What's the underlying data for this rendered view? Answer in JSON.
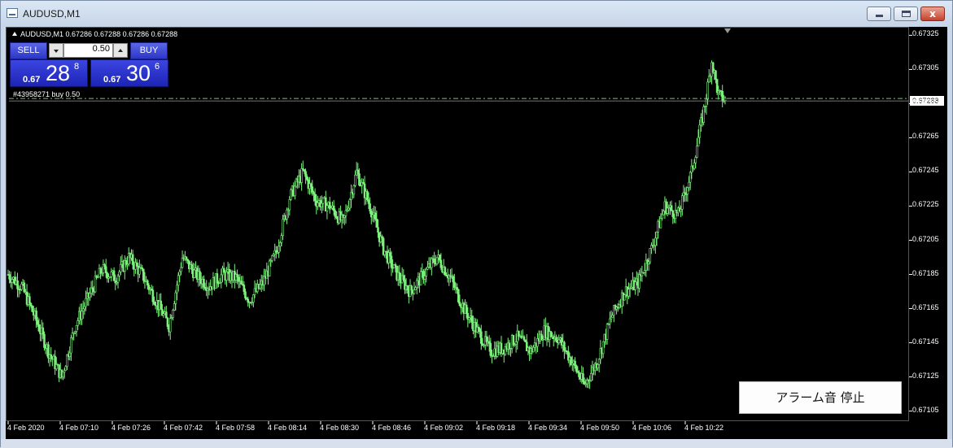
{
  "window": {
    "title": "AUDUSD,M1",
    "close_glyph": "x"
  },
  "symbol_info": "AUDUSD,M1  0.67286 0.67288 0.67286 0.67288",
  "trade_panel": {
    "sell_label": "SELL",
    "buy_label": "BUY",
    "lot_value": "0.50",
    "sell_quote": {
      "prefix": "0.67",
      "big": "28",
      "small": "8"
    },
    "buy_quote": {
      "prefix": "0.67",
      "big": "30",
      "small": "6"
    }
  },
  "order_line_label": "#43958271 buy 0.50",
  "alarm_button_label": "アラーム音 停止",
  "current_price": "0.67288",
  "colors": {
    "background": "#000000",
    "candle": "#7cf27c",
    "order_line": "#7cbf7c",
    "accent_blue": "#2c36c8"
  },
  "chart_data": {
    "type": "candlestick",
    "symbol": "AUDUSD",
    "timeframe": "M1",
    "ylim": [
      0.67101,
      0.67329
    ],
    "price_ticks": [
      "0.67325",
      "0.67305",
      "0.67285",
      "0.67265",
      "0.67245",
      "0.67225",
      "0.67205",
      "0.67185",
      "0.67165",
      "0.67145",
      "0.67125",
      "0.67105"
    ],
    "time_ticks": [
      "4 Feb 2020",
      "4 Feb 07:10",
      "4 Feb 07:26",
      "4 Feb 07:42",
      "4 Feb 07:58",
      "4 Feb 08:14",
      "4 Feb 08:30",
      "4 Feb 08:46",
      "4 Feb 09:02",
      "4 Feb 09:18",
      "4 Feb 09:34",
      "4 Feb 09:50",
      "4 Feb 10:06",
      "4 Feb 10:22"
    ],
    "order_line_price": 0.67288,
    "close_path": [
      [
        0,
        0.67185
      ],
      [
        10,
        0.67178
      ],
      [
        20,
        0.6716
      ],
      [
        30,
        0.6714
      ],
      [
        40,
        0.67125
      ],
      [
        50,
        0.67155
      ],
      [
        60,
        0.67172
      ],
      [
        70,
        0.67188
      ],
      [
        80,
        0.67183
      ],
      [
        90,
        0.67195
      ],
      [
        100,
        0.67185
      ],
      [
        110,
        0.6717
      ],
      [
        120,
        0.67155
      ],
      [
        130,
        0.67195
      ],
      [
        140,
        0.67185
      ],
      [
        150,
        0.67178
      ],
      [
        160,
        0.67185
      ],
      [
        170,
        0.67183
      ],
      [
        180,
        0.6717
      ],
      [
        190,
        0.6718
      ],
      [
        200,
        0.67198
      ],
      [
        210,
        0.6723
      ],
      [
        220,
        0.67245
      ],
      [
        230,
        0.67228
      ],
      [
        240,
        0.67225
      ],
      [
        250,
        0.67215
      ],
      [
        260,
        0.67245
      ],
      [
        270,
        0.67225
      ],
      [
        280,
        0.672
      ],
      [
        290,
        0.67185
      ],
      [
        300,
        0.67175
      ],
      [
        310,
        0.67185
      ],
      [
        320,
        0.67195
      ],
      [
        330,
        0.67183
      ],
      [
        340,
        0.67165
      ],
      [
        350,
        0.67152
      ],
      [
        360,
        0.6714
      ],
      [
        370,
        0.67142
      ],
      [
        380,
        0.67148
      ],
      [
        390,
        0.6714
      ],
      [
        400,
        0.67152
      ],
      [
        410,
        0.67148
      ],
      [
        420,
        0.67135
      ],
      [
        430,
        0.6712
      ],
      [
        440,
        0.67135
      ],
      [
        450,
        0.6716
      ],
      [
        460,
        0.67175
      ],
      [
        470,
        0.6718
      ],
      [
        480,
        0.672
      ],
      [
        490,
        0.67225
      ],
      [
        500,
        0.6722
      ],
      [
        510,
        0.67245
      ],
      [
        520,
        0.67285
      ],
      [
        525,
        0.6731
      ],
      [
        530,
        0.6729
      ],
      [
        535,
        0.67287
      ]
    ]
  }
}
